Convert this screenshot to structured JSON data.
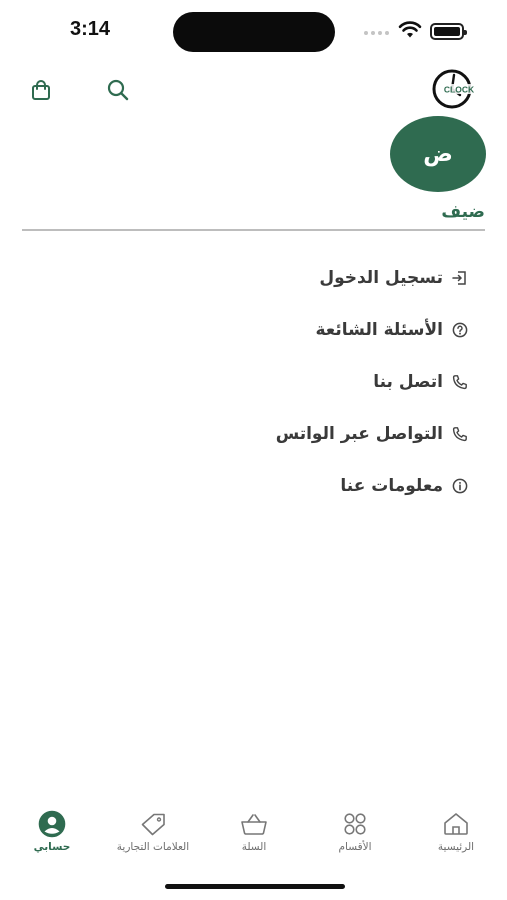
{
  "status_bar": {
    "time": "3:14"
  },
  "header": {
    "logo_text": "CLOCK"
  },
  "profile": {
    "avatar_letter": "ض",
    "name": "ضيف"
  },
  "menu": [
    {
      "label": "تسجيل الدخول",
      "icon": "login-icon"
    },
    {
      "label": "الأسئلة الشائعة",
      "icon": "help-circle-icon"
    },
    {
      "label": "اتصل بنا",
      "icon": "phone-icon"
    },
    {
      "label": "التواصل عبر الواتس",
      "icon": "whatsapp-phone-icon"
    },
    {
      "label": "معلومات عنا",
      "icon": "info-icon"
    }
  ],
  "bottom_nav": [
    {
      "label": "الرئيسية",
      "icon": "home-icon"
    },
    {
      "label": "الأقسام",
      "icon": "categories-icon"
    },
    {
      "label": "السلة",
      "icon": "basket-icon"
    },
    {
      "label": "العلامات التجارية",
      "icon": "tag-icon"
    },
    {
      "label": "حسابي",
      "icon": "account-icon",
      "active": true
    }
  ],
  "colors": {
    "accent": "#2f6b50",
    "text": "#3a3a3a",
    "muted": "#6e6e6e"
  }
}
